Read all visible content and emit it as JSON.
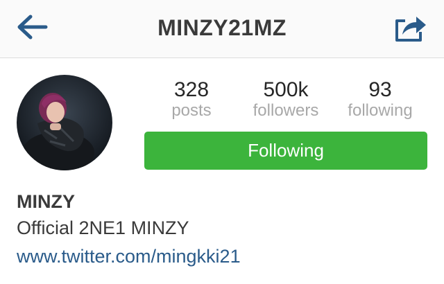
{
  "header": {
    "title": "MINZY21MZ",
    "back_icon": "back-arrow-icon",
    "share_icon": "share-icon",
    "accent": "#2a5b8a"
  },
  "stats": [
    {
      "value": "328",
      "label": "posts"
    },
    {
      "value": "500k",
      "label": "followers"
    },
    {
      "value": "93",
      "label": "following"
    }
  ],
  "follow_button": {
    "label": "Following",
    "color": "#3cb43c"
  },
  "bio": {
    "name": "MINZY",
    "text": "Official 2NE1 MINZY",
    "link": "www.twitter.com/mingkki21"
  }
}
